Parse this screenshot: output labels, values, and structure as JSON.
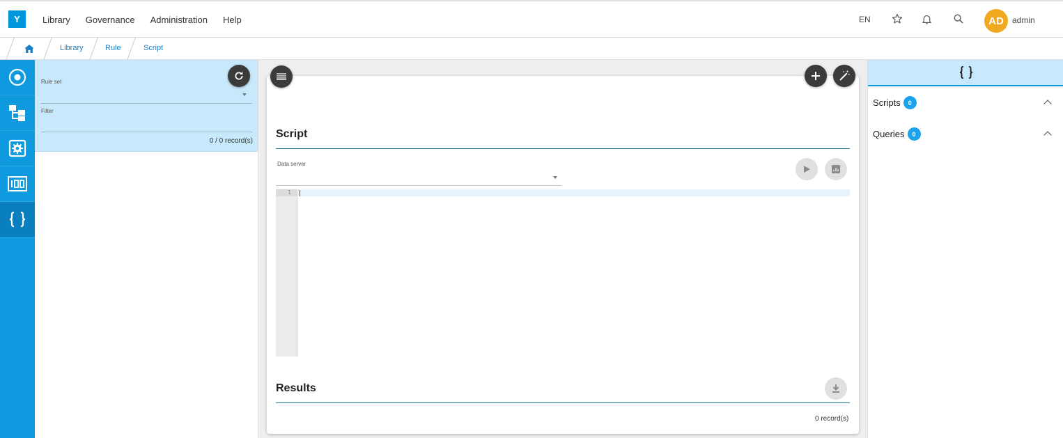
{
  "app": {
    "logo_letter": "Y"
  },
  "nav": {
    "menu": [
      "Library",
      "Governance",
      "Administration",
      "Help"
    ],
    "language": "EN",
    "user_initials": "AD",
    "username": "admin"
  },
  "breadcrumb": [
    "Library",
    "Rule",
    "Script"
  ],
  "left_panel": {
    "rule_set_label": "Rule set",
    "filter_label": "Filter",
    "records": "0 / 0 record(s)"
  },
  "script_section": {
    "title": "Script",
    "data_server_label": "Data server",
    "line_number": "1"
  },
  "results_section": {
    "title": "Results",
    "records": "0 record(s)"
  },
  "right_panel": {
    "header_icon": "curly-braces-icon",
    "scripts_label": "Scripts",
    "scripts_count": "0",
    "queries_label": "Queries",
    "queries_count": "0"
  },
  "colors": {
    "brand": "#0096dc",
    "rail": "#0f9ae0",
    "panel_highlight": "#c7e9fb",
    "avatar": "#f0a920",
    "badge": "#1aa3ea"
  }
}
